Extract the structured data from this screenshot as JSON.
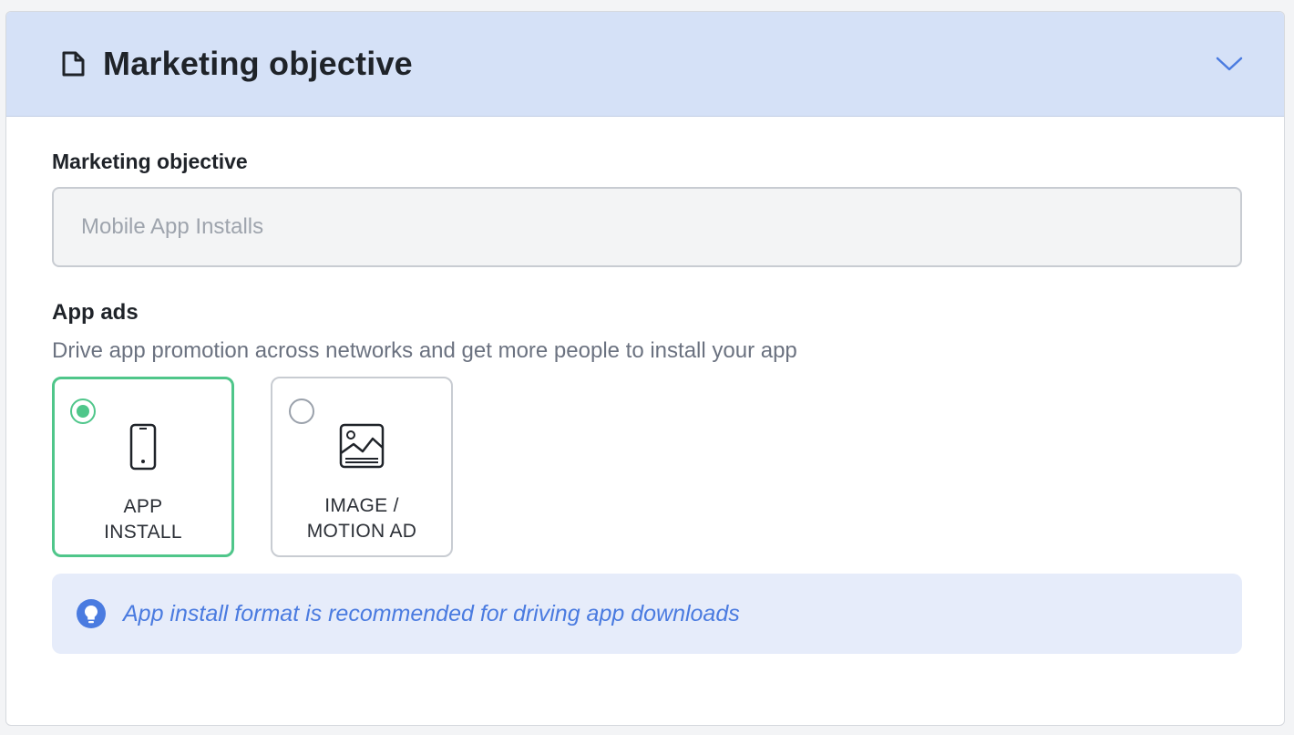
{
  "header": {
    "title": "Marketing objective",
    "icon": "document-icon",
    "toggle_icon": "chevron-down-icon"
  },
  "objective_field": {
    "label": "Marketing objective",
    "value": "Mobile App Installs"
  },
  "app_ads": {
    "title": "App ads",
    "description": "Drive app promotion across networks and get more people to install your app",
    "options": [
      {
        "label": "APP\nINSTALL",
        "icon": "smartphone-icon",
        "selected": true
      },
      {
        "label": "IMAGE /\nMOTION AD",
        "icon": "image-icon",
        "selected": false
      }
    ]
  },
  "info": {
    "icon": "lightbulb-icon",
    "text": "App install format is recommended for driving app downloads"
  },
  "colors": {
    "header_bg": "#d5e1f7",
    "selected_accent": "#4fc68a",
    "info_bg": "#e6ecfa",
    "info_text": "#4a7be0"
  }
}
